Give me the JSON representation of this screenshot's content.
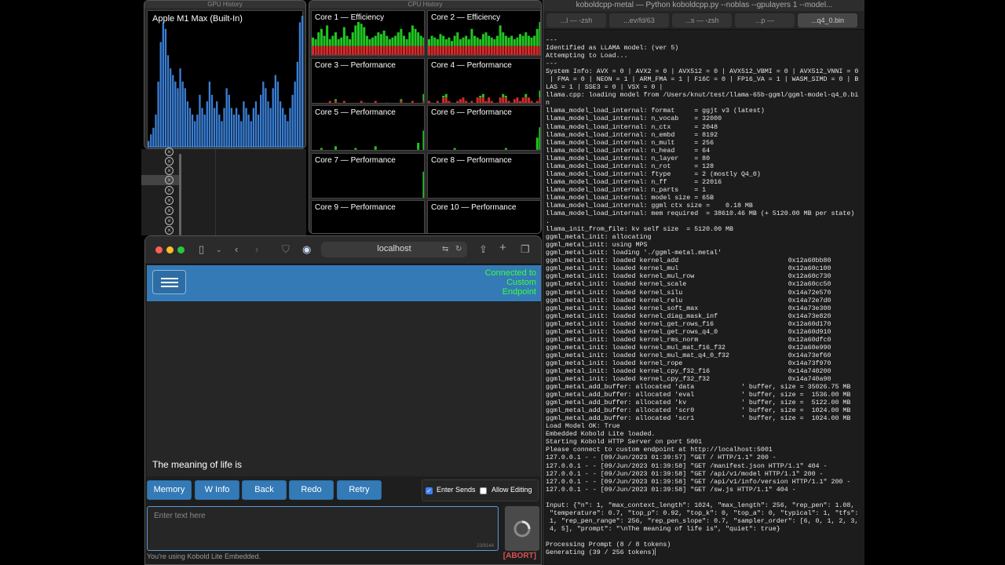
{
  "gpu_window": {
    "title": "GPU History",
    "label": "Apple M1 Max (Built-In)",
    "bars": [
      0.05,
      0.1,
      0.15,
      0.25,
      0.5,
      0.8,
      0.95,
      0.9,
      0.7,
      0.6,
      0.55,
      0.5,
      0.45,
      0.6,
      0.5,
      0.45,
      0.35,
      0.3,
      0.25,
      0.2,
      0.25,
      0.4,
      0.3,
      0.25,
      0.35,
      0.5,
      0.4,
      0.3,
      0.35,
      0.25,
      0.2,
      0.3,
      0.45,
      0.4,
      0.3,
      0.25,
      0.3,
      0.25,
      0.2,
      0.35,
      0.3,
      0.25,
      0.2,
      0.3,
      0.35,
      0.25,
      0.4,
      0.5,
      0.45,
      0.35,
      0.3,
      0.45,
      0.55,
      0.5,
      0.35,
      0.3,
      0.25,
      0.2,
      0.3,
      0.4,
      0.5,
      0.65,
      0.95,
      1.0
    ],
    "colors": {
      "bar": "#3a7fd5",
      "bar_top": "#9ec8ff"
    }
  },
  "cpu_window": {
    "title": "CPU History",
    "cores": [
      {
        "label": "Core 1 — Efficiency",
        "bars": [
          0.55,
          0.5,
          0.7,
          0.8,
          0.6,
          0.9,
          0.5,
          0.6,
          0.7,
          0.5,
          0.55,
          0.85,
          0.6,
          0.5,
          0.7,
          0.9,
          1.0,
          0.95,
          0.85,
          0.6,
          0.5,
          0.55,
          0.6,
          0.7,
          0.65,
          0.75,
          0.6,
          0.5,
          0.55,
          0.6,
          0.7,
          0.8,
          0.6,
          0.5,
          0.7,
          0.9,
          0.8,
          0.7,
          0.6,
          0.55
        ],
        "red": 0.3
      },
      {
        "label": "Core 2 — Efficiency",
        "bars": [
          0.5,
          0.6,
          0.55,
          0.5,
          0.65,
          0.6,
          0.5,
          0.55,
          0.45,
          0.6,
          0.7,
          0.5,
          0.55,
          0.6,
          0.5,
          0.8,
          0.6,
          0.55,
          0.5,
          0.65,
          0.7,
          0.6,
          0.55,
          0.5,
          0.6,
          0.9,
          0.7,
          0.6,
          0.55,
          0.6,
          0.5,
          0.55,
          0.65,
          0.6,
          0.7,
          0.6,
          0.55,
          0.6,
          0.8,
          1.0
        ],
        "red": 0.3
      },
      {
        "label": "Core 3 — Performance",
        "bars": [
          0,
          0,
          0,
          0,
          0,
          0,
          0.1,
          0,
          0.15,
          0.05,
          0,
          0.1,
          0,
          0,
          0,
          0,
          0,
          0.1,
          0.05,
          0,
          0,
          0,
          0.1,
          0,
          0,
          0,
          0.05,
          0,
          0,
          0,
          0,
          0.15,
          0,
          0,
          0,
          0.1,
          0,
          0,
          0,
          0.3
        ],
        "red": 0.1
      },
      {
        "label": "Core 4 — Performance",
        "bars": [
          0.1,
          0.05,
          0,
          0.1,
          0,
          0.25,
          0.3,
          0.1,
          0.05,
          0,
          0.1,
          0.15,
          0.2,
          0.1,
          0.05,
          0.1,
          0,
          0.2,
          0.25,
          0.3,
          0.1,
          0.2,
          0.1,
          0,
          0.05,
          0.2,
          0.3,
          0.25,
          0.1,
          0.05,
          0.15,
          0.2,
          0.1,
          0.2,
          0.3,
          0.2,
          0.1,
          0.05,
          0.1,
          0.4
        ],
        "red": 0.2
      },
      {
        "label": "Core 5 — Performance",
        "bars": [
          0,
          0,
          0,
          0.1,
          0,
          0,
          0,
          0,
          0.15,
          0,
          0,
          0,
          0,
          0,
          0,
          0.1,
          0,
          0,
          0,
          0,
          0,
          0,
          0.15,
          0,
          0,
          0,
          0,
          0,
          0,
          0,
          0,
          0,
          0,
          0,
          0,
          0,
          0,
          0.25,
          0,
          0.6
        ],
        "red": 0.05
      },
      {
        "label": "Core 6 — Performance",
        "bars": [
          0,
          0,
          0,
          0,
          0,
          0,
          0,
          0,
          0,
          0.1,
          0,
          0,
          0,
          0,
          0,
          0,
          0,
          0,
          0,
          0,
          0,
          0,
          0,
          0,
          0,
          0,
          0,
          0.1,
          0,
          0,
          0,
          0,
          0,
          0,
          0,
          0,
          0,
          0,
          0.4,
          0.7
        ],
        "red": 0.05
      },
      {
        "label": "Core 7 — Performance",
        "bars": [
          0,
          0,
          0,
          0,
          0,
          0,
          0,
          0,
          0,
          0,
          0,
          0,
          0,
          0,
          0,
          0,
          0,
          0,
          0,
          0,
          0,
          0,
          0,
          0,
          0,
          0,
          0,
          0,
          0,
          0,
          0,
          0,
          0,
          0,
          0,
          0,
          0,
          0,
          0,
          0.8
        ],
        "red": 0.02
      },
      {
        "label": "Core 8 — Performance",
        "bars": [
          0,
          0,
          0,
          0,
          0,
          0,
          0,
          0,
          0,
          0,
          0,
          0,
          0,
          0,
          0,
          0,
          0,
          0,
          0,
          0,
          0,
          0,
          0,
          0,
          0,
          0,
          0,
          0,
          0,
          0,
          0,
          0,
          0,
          0,
          0,
          0,
          0,
          0,
          0,
          0
        ],
        "red": 0.02
      },
      {
        "label": "Core 9 — Performance",
        "bars": [],
        "red": 0
      },
      {
        "label": "Core 10 — Performance",
        "bars": [],
        "red": 0
      }
    ],
    "colors": {
      "user": "#22c422",
      "system": "#d42a2a"
    }
  },
  "browser": {
    "url": "localhost",
    "connection_status": "Connected to Custom Endpoint",
    "story_text": "The meaning of life is",
    "buttons": {
      "memory": "Memory",
      "winfo": "W Info",
      "back": "Back",
      "redo": "Redo",
      "retry": "Retry"
    },
    "options": {
      "enter_sends": "Enter Sends",
      "enter_sends_checked": true,
      "allow_editing": "Allow Editing",
      "allow_editing_checked": false
    },
    "input_placeholder": "Enter text here",
    "char_count": "23/8144",
    "footer_note": "You're using Kobold Lite Embedded.",
    "abort": "[ABORT]",
    "colors": {
      "accent": "#337ab7",
      "status": "#3bff3b",
      "abort": "#d9534f"
    }
  },
  "terminal": {
    "title": "koboldcpp-metal — Python koboldcpp.py --noblas --gpulayers 1 --model...",
    "tabs": [
      "...l — -zsh",
      "...ev/fd/63",
      "...s — -zsh",
      "...p —",
      "...q4_0.bin"
    ],
    "lines": [
      "---",
      "Identified as LLAMA model: (ver 5)",
      "Attempting to Load...",
      "---",
      "System Info: AVX = 0 | AVX2 = 0 | AVX512 = 0 | AVX512_VBMI = 0 | AVX512_VNNI = 0",
      " | FMA = 0 | NEON = 1 | ARM_FMA = 1 | F16C = 0 | FP16_VA = 1 | WASM_SIMD = 0 | B",
      "LAS = 1 | SSE3 = 0 | VSX = 0 |",
      "llama.cpp: loading model from /Users/knut/test/llama-65b-ggml/ggml-model-q4_0.bi",
      "n",
      "llama_model_load_internal: format     = ggjt v3 (latest)",
      "llama_model_load_internal: n_vocab    = 32000",
      "llama_model_load_internal: n_ctx      = 2048",
      "llama_model_load_internal: n_embd     = 8192",
      "llama_model_load_internal: n_mult     = 256",
      "llama_model_load_internal: n_head     = 64",
      "llama_model_load_internal: n_layer    = 80",
      "llama_model_load_internal: n_rot      = 128",
      "llama_model_load_internal: ftype      = 2 (mostly Q4_0)",
      "llama_model_load_internal: n_ff       = 22016",
      "llama_model_load_internal: n_parts    = 1",
      "llama_model_load_internal: model size = 65B",
      "llama_model_load_internal: ggml ctx size =    0.18 MB",
      "llama_model_load_internal: mem required  = 38610.46 MB (+ 5120.00 MB per state)",
      ".",
      "llama_init_from_file: kv self size  = 5120.00 MB",
      "ggml_metal_init: allocating",
      "ggml_metal_init: using MPS",
      "ggml_metal_init: loading './ggml-metal.metal'",
      "ggml_metal_init: loaded kernel_add                            0x12a60bb80",
      "ggml_metal_init: loaded kernel_mul                            0x12a60c100",
      "ggml_metal_init: loaded kernel_mul_row                        0x12a60c730",
      "ggml_metal_init: loaded kernel_scale                          0x12a60cc50",
      "ggml_metal_init: loaded kernel_silu                           0x14a72e570",
      "ggml_metal_init: loaded kernel_relu                           0x14a72e7d0",
      "ggml_metal_init: loaded kernel_soft_max                       0x14a73e300",
      "ggml_metal_init: loaded kernel_diag_mask_inf                  0x14a73e820",
      "ggml_metal_init: loaded kernel_get_rows_f16                   0x12a60d170",
      "ggml_metal_init: loaded kernel_get_rows_q4_0                  0x12a60d910",
      "ggml_metal_init: loaded kernel_rms_norm                       0x12a60dfc0",
      "ggml_metal_init: loaded kernel_mul_mat_f16_f32                0x12a60e990",
      "ggml_metal_init: loaded kernel_mul_mat_q4_0_f32               0x14a73ef60",
      "ggml_metal_init: loaded kernel_rope                           0x14a73f970",
      "ggml_metal_init: loaded kernel_cpy_f32_f16                    0x14a740200",
      "ggml_metal_init: loaded kernel_cpy_f32_f32                    0x14a740a90",
      "ggml_metal_add_buffer: allocated 'data            ' buffer, size = 35026.75 MB",
      "ggml_metal_add_buffer: allocated 'eval            ' buffer, size =  1536.00 MB",
      "ggml_metal_add_buffer: allocated 'kv              ' buffer, size =  5122.00 MB",
      "ggml_metal_add_buffer: allocated 'scr0            ' buffer, size =  1024.00 MB",
      "ggml_metal_add_buffer: allocated 'scr1            ' buffer, size =  1024.00 MB",
      "Load Model OK: True",
      "Embedded Kobold Lite loaded.",
      "Starting Kobold HTTP Server on port 5001",
      "Please connect to custom endpoint at http://localhost:5001",
      "127.0.0.1 - - [09/Jun/2023 01:39:57] \"GET / HTTP/1.1\" 200 -",
      "127.0.0.1 - - [09/Jun/2023 01:39:58] \"GET /manifest.json HTTP/1.1\" 404 -",
      "127.0.0.1 - - [09/Jun/2023 01:39:58] \"GET /api/v1/model HTTP/1.1\" 200 -",
      "127.0.0.1 - - [09/Jun/2023 01:39:58] \"GET /api/v1/info/version HTTP/1.1\" 200 -",
      "127.0.0.1 - - [09/Jun/2023 01:39:58] \"GET /sw.js HTTP/1.1\" 404 -",
      "",
      "Input: {\"n\": 1, \"max_context_length\": 1024, \"max_length\": 256, \"rep_pen\": 1.08,",
      " \"temperature\": 0.7, \"top_p\": 0.92, \"top_k\": 0, \"top_a\": 0, \"typical\": 1, \"tfs\":",
      " 1, \"rep_pen_range\": 256, \"rep_pen_slope\": 0.7, \"sampler_order\": [6, 0, 1, 2, 3,",
      " 4, 5], \"prompt\": \"\\nThe meaning of life is\", \"quiet\": true}",
      "",
      "Processing Prompt (8 / 8 tokens)",
      "Generating (39 / 256 tokens)"
    ]
  }
}
